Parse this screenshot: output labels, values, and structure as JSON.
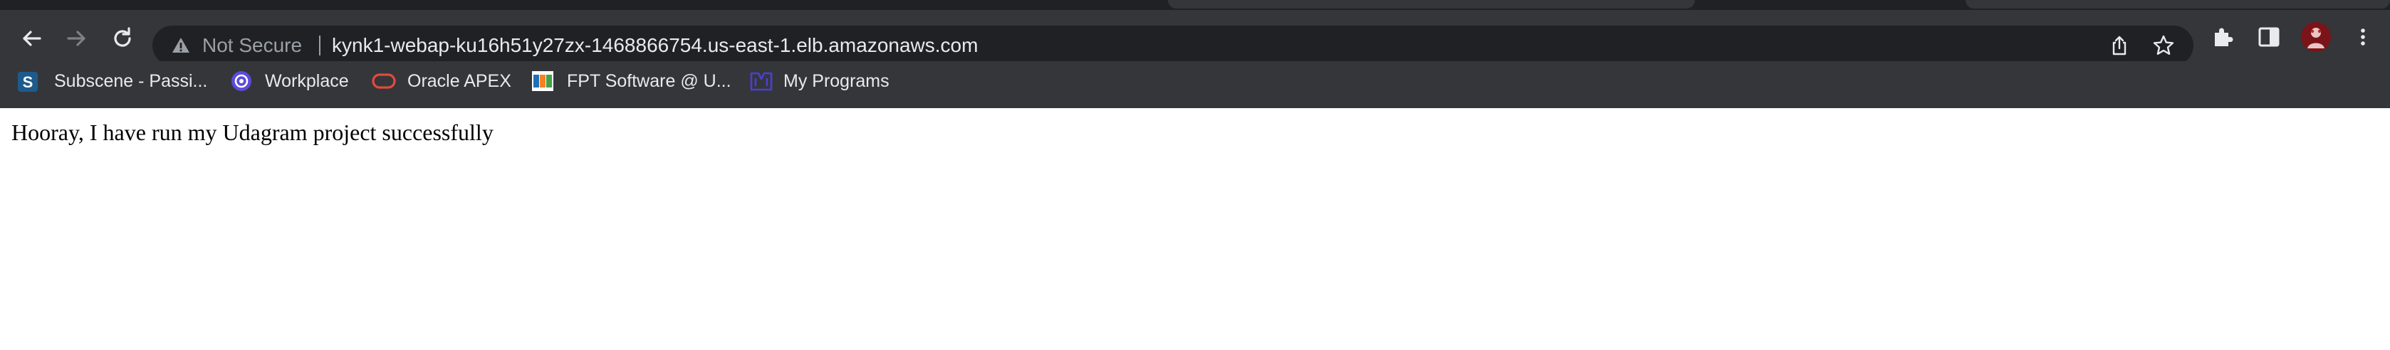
{
  "browser": {
    "theme": {
      "frame": "#202124",
      "toolbar": "#35363a",
      "omnibox": "#202124",
      "text": "#e8eaed",
      "muted": "#9aa0a6"
    },
    "toolbar": {
      "back_icon": "arrow-left-icon",
      "forward_icon": "arrow-right-icon",
      "reload_icon": "reload-icon",
      "security_icon": "warning-triangle-icon",
      "security_text": "Not Secure",
      "url": "kynk1-webap-ku16h51y27zx-1468866754.us-east-1.elb.amazonaws.com",
      "share_icon": "share-icon",
      "bookmark_star_icon": "star-icon",
      "extensions_icon": "puzzle-icon",
      "side_panel_icon": "side-panel-icon",
      "profile_icon": "avatar",
      "menu_icon": "kebab-menu-icon"
    },
    "bookmarks": [
      {
        "label": "Subscene - Passi...",
        "icon": "subscene-favicon"
      },
      {
        "label": "Workplace",
        "icon": "workplace-favicon"
      },
      {
        "label": "Oracle APEX",
        "icon": "oracle-favicon"
      },
      {
        "label": "FPT Software @ U...",
        "icon": "fpt-favicon"
      },
      {
        "label": "My Programs",
        "icon": "programs-favicon"
      }
    ]
  },
  "page": {
    "body_text": "Hooray, I have run my Udagram project successfully"
  }
}
